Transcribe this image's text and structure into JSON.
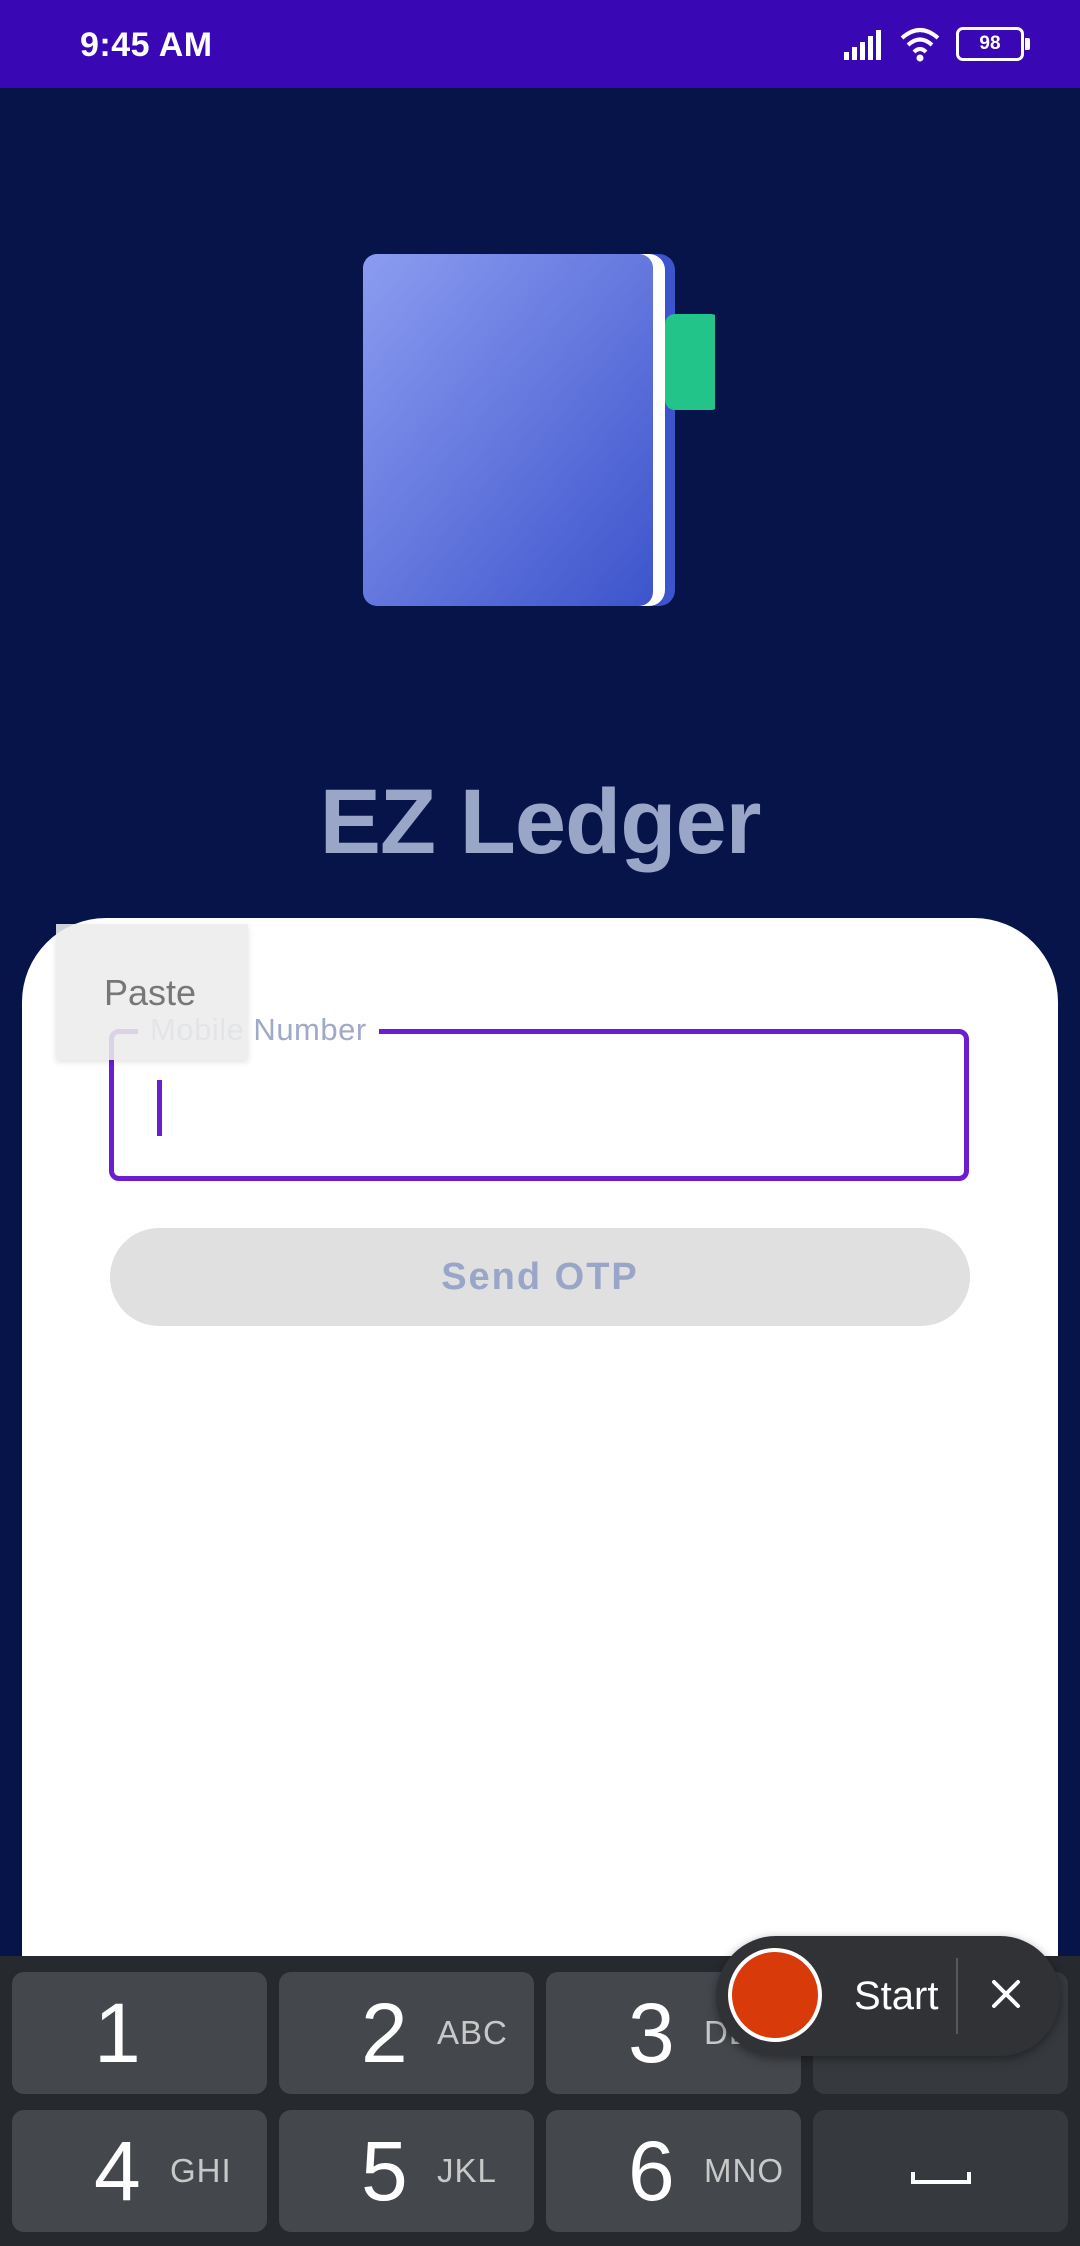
{
  "status_bar": {
    "time": "9:45 AM",
    "battery": "98",
    "icons": [
      "signal-icon",
      "wifi-icon",
      "battery-icon"
    ]
  },
  "app": {
    "title": "EZ Ledger",
    "logo": "ledger-book-logo",
    "colors": {
      "background": "#06144a",
      "accent": "#6a1ecf",
      "status_bar": "#3a07b4",
      "logo_tab": "#22c48a"
    }
  },
  "login_form": {
    "mobile_label": "Mobile Number",
    "mobile_value": "",
    "send_otp_label": "Send OTP"
  },
  "context_menu": {
    "paste_label": "Paste"
  },
  "recorder": {
    "start_label": "Start",
    "icons": [
      "record-icon",
      "close-icon"
    ]
  },
  "keyboard": {
    "keys": [
      {
        "digit": "1",
        "letters": ""
      },
      {
        "digit": "2",
        "letters": "ABC"
      },
      {
        "digit": "3",
        "letters": "DEF"
      },
      {
        "digit": "4",
        "letters": "GHI"
      },
      {
        "digit": "5",
        "letters": "JKL"
      },
      {
        "digit": "6",
        "letters": "MNO"
      }
    ],
    "space_icon": "space-bar-icon"
  }
}
